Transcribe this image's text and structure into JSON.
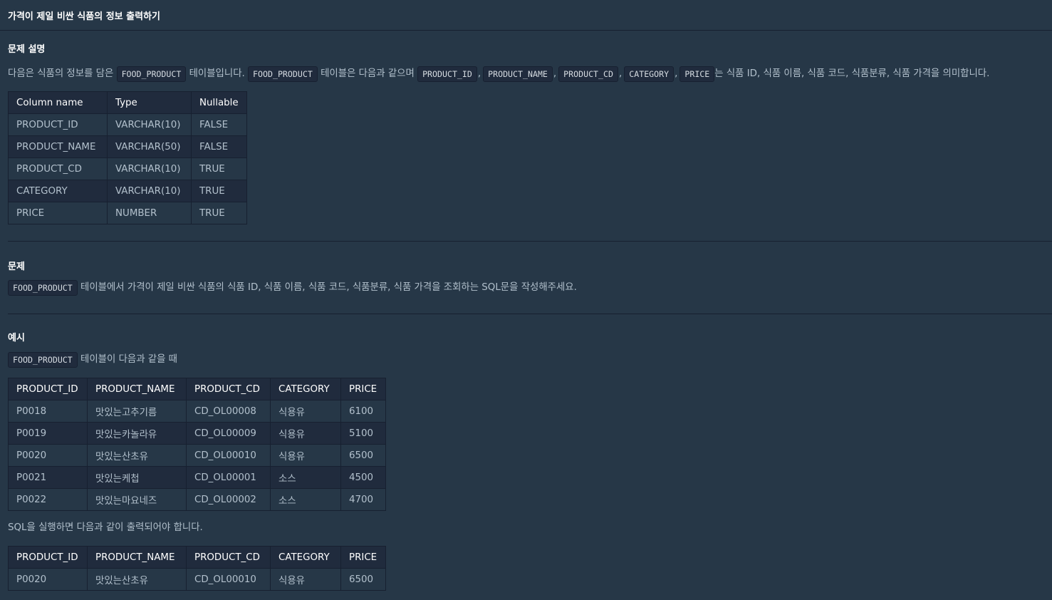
{
  "title": "가격이 제일 비싼 식품의 정보 출력하기",
  "description": {
    "heading": "문제 설명",
    "sentence": {
      "t1": "다음은 식품의 정보를 담은",
      "c1": "FOOD_PRODUCT",
      "t2": "테이블입니다.",
      "c2": "FOOD_PRODUCT",
      "t3": "테이블은 다음과 같으며",
      "c3": "PRODUCT_ID",
      "sep1": ",",
      "c4": "PRODUCT_NAME",
      "sep2": ",",
      "c5": "PRODUCT_CD",
      "sep3": ",",
      "c6": "CATEGORY",
      "sep4": ",",
      "c7": "PRICE",
      "t4": "는 식품 ID, 식품 이름, 식품 코드, 식품분류, 식품 가격을 의미합니다."
    },
    "schema_table": {
      "headers": [
        "Column name",
        "Type",
        "Nullable"
      ],
      "rows": [
        [
          "PRODUCT_ID",
          "VARCHAR(10)",
          "FALSE"
        ],
        [
          "PRODUCT_NAME",
          "VARCHAR(50)",
          "FALSE"
        ],
        [
          "PRODUCT_CD",
          "VARCHAR(10)",
          "TRUE"
        ],
        [
          "CATEGORY",
          "VARCHAR(10)",
          "TRUE"
        ],
        [
          "PRICE",
          "NUMBER",
          "TRUE"
        ]
      ]
    }
  },
  "problem": {
    "heading": "문제",
    "code": "FOOD_PRODUCT",
    "text": "테이블에서 가격이 제일 비싼 식품의 식품 ID, 식품 이름, 식품 코드, 식품분류, 식품 가격을 조회하는 SQL문을 작성해주세요."
  },
  "example": {
    "heading": "예시",
    "code": "FOOD_PRODUCT",
    "text": "테이블이 다음과 같을 때",
    "input_table": {
      "headers": [
        "PRODUCT_ID",
        "PRODUCT_NAME",
        "PRODUCT_CD",
        "CATEGORY",
        "PRICE"
      ],
      "rows": [
        [
          "P0018",
          "맛있는고추기름",
          "CD_OL00008",
          "식용유",
          "6100"
        ],
        [
          "P0019",
          "맛있는카놀라유",
          "CD_OL00009",
          "식용유",
          "5100"
        ],
        [
          "P0020",
          "맛있는산초유",
          "CD_OL00010",
          "식용유",
          "6500"
        ],
        [
          "P0021",
          "맛있는케첩",
          "CD_OL00001",
          "소스",
          "4500"
        ],
        [
          "P0022",
          "맛있는마요네즈",
          "CD_OL00002",
          "소스",
          "4700"
        ]
      ]
    },
    "result_text": "SQL을 실행하면 다음과 같이 출력되어야 합니다.",
    "output_table": {
      "headers": [
        "PRODUCT_ID",
        "PRODUCT_NAME",
        "PRODUCT_CD",
        "CATEGORY",
        "PRICE"
      ],
      "rows": [
        [
          "P0020",
          "맛있는산초유",
          "CD_OL00010",
          "식용유",
          "6500"
        ]
      ]
    }
  }
}
